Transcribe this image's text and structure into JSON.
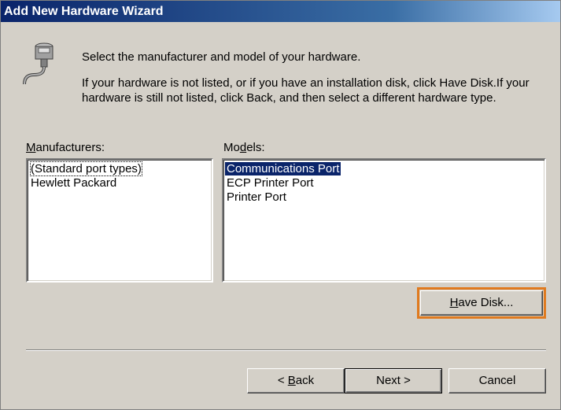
{
  "window": {
    "title": "Add New Hardware Wizard"
  },
  "intro": {
    "line1": "Select the manufacturer and model of your hardware.",
    "line2": "If your hardware is not listed, or if you have an installation disk, click Have Disk.If your hardware is still not listed, click Back, and then select a different hardware type."
  },
  "manufacturers": {
    "label_prefix": "M",
    "label_rest": "anufacturers:",
    "items": [
      "(Standard port types)",
      "Hewlett Packard"
    ]
  },
  "models": {
    "label_prefix": "Mo",
    "label_accel": "d",
    "label_rest": "els:",
    "items": [
      "Communications Port",
      "ECP Printer Port",
      "Printer Port"
    ]
  },
  "buttons": {
    "have_disk_accel": "H",
    "have_disk_rest": "ave Disk...",
    "back_prefix": "< ",
    "back_accel": "B",
    "back_rest": "ack",
    "next": "Next >",
    "cancel": "Cancel"
  },
  "icon": "serial-port-connector-icon",
  "highlight_color": "#e07a1f"
}
